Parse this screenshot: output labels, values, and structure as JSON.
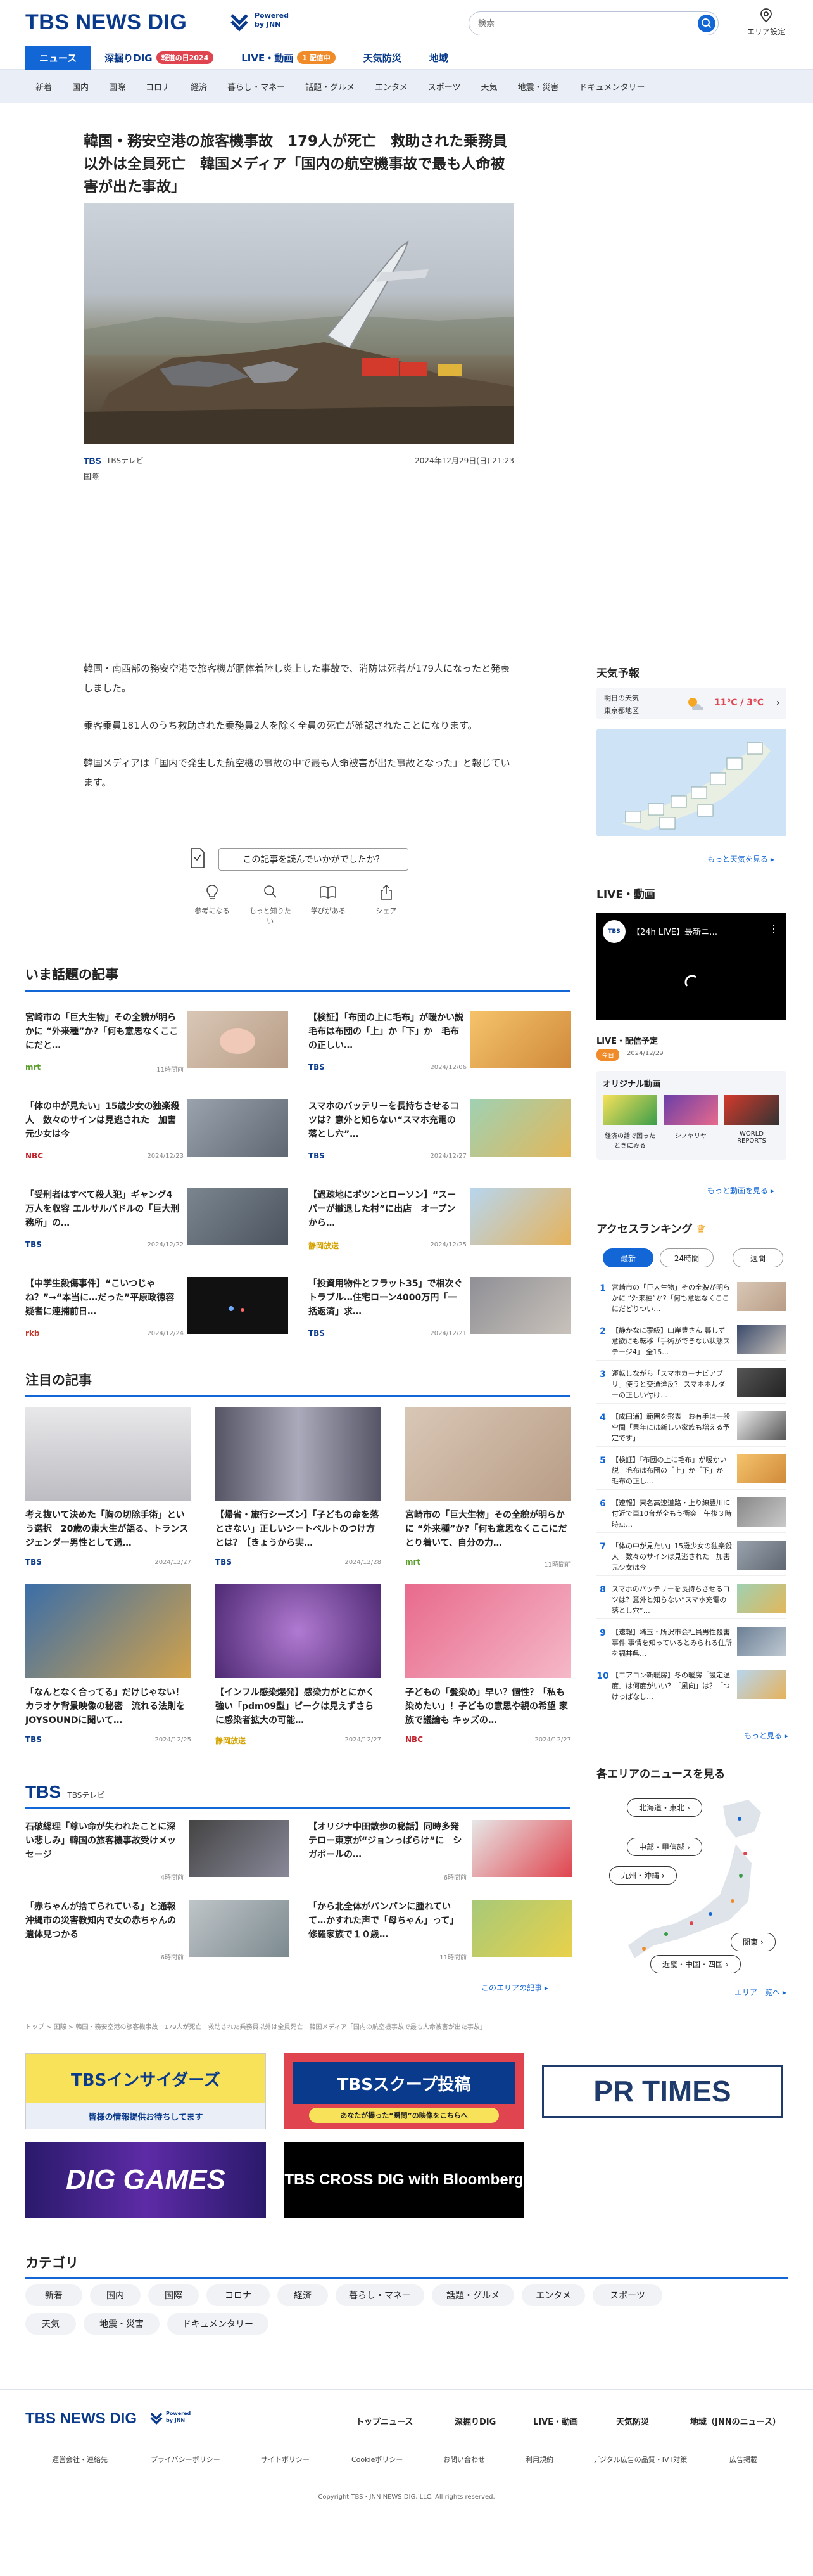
{
  "header": {
    "logo": "TBS NEWS DIG",
    "powered_line1": "Powered",
    "powered_line2": "by JNN",
    "search_placeholder": "検索",
    "area_label": "エリア設定"
  },
  "main_nav": [
    {
      "label": "ニュース",
      "badge": ""
    },
    {
      "label": "深掘りDIG",
      "badge": "報道の日2024"
    },
    {
      "label": "LIVE・動画",
      "badge": "1 配信中"
    },
    {
      "label": "天気防災",
      "badge": ""
    },
    {
      "label": "地域",
      "badge": ""
    }
  ],
  "colors": {
    "brand": "#0a3a8c",
    "accent": "#1266d6",
    "badge_red": "#e0454f",
    "badge_orange": "#f08b2a"
  },
  "sub_nav": [
    "新着",
    "国内",
    "国際",
    "コロナ",
    "経済",
    "暮らし・マネー",
    "話題・グルメ",
    "エンタメ",
    "スポーツ",
    "天気",
    "地震・災害",
    "ドキュメンタリー"
  ],
  "article": {
    "headline": "韓国・務安空港の旅客機事故　179人が死亡　救助された乗務員以外は全員死亡　韓国メディア「国内の航空機事故で最も人命被害が出た事故」",
    "source": "TBSテレビ",
    "category_tag": "国際",
    "datetime": "2024年12月29日(日) 21:23",
    "paragraphs": [
      "韓国・南西部の務安空港で旅客機が胴体着陸し炎上した事故で、消防は死者が179人になったと発表しました。",
      "乗客乗員181人のうち救助された乗務員2人を除く全員の死亡が確認されたことになります。",
      "韓国メディアは「国内で発生した航空機の事故の中で最も人命被害が出た事故となった」と報じています。"
    ],
    "feedback_label": "この記事を読んでいかがでしたか？",
    "reactions": [
      "参考になる",
      "もっと知りたい",
      "学びがある",
      "シェア"
    ]
  },
  "trending": {
    "title": "いま話題の記事",
    "items": [
      {
        "title": "宮崎市の「巨大生物」その全貌が明らかに “外来種”か?「何も意思なくここにだと…",
        "source": "mrt",
        "date": "11時間前"
      },
      {
        "title": "【検証】「布団の上に毛布」が暖かい説　毛布は布団の「上」か「下」か　毛布の正しい…",
        "source": "TBS",
        "date": "2024/12/06"
      },
      {
        "title": "「体の中が見たい」15歳少女の独楽殺人　数々のサインは見逃された　加害元少女は今",
        "source": "NBC",
        "date": "2024/12/23"
      },
      {
        "title": "スマホのバッテリーを長持ちさせるコツは？意外と知らない“スマホ充電の落とし穴”…",
        "source": "TBS",
        "date": "2024/12/27"
      },
      {
        "title": "「受刑者はすべて殺人犯」ギャング4万人を収容 エルサルバドルの「巨大刑務所」の…",
        "source": "TBS",
        "date": "2024/12/22"
      },
      {
        "title": "【過疎地にポツンとローソン】“スーパーが撤退した村”に出店　オープンから…",
        "source": "静岡放送",
        "date": "2024/12/25"
      },
      {
        "title": "【中学生殺傷事件】“こいつじゃね？”→“本当に…だった”平原政徳容疑者に連捕前日…",
        "source": "rkb",
        "date": "2024/12/24"
      },
      {
        "title": "「投資用物件とフラット35」で相次ぐトラブル…住宅ローン4000万円「一括返済」求…",
        "source": "TBS",
        "date": "2024/12/21"
      }
    ]
  },
  "featured": {
    "title": "注目の記事",
    "items": [
      {
        "title": "考え抜いて決めた「胸の切除手術」という選択　20歳の東大生が語る、トランスジェンダー男性として過…",
        "source": "TBS",
        "date": "2024/12/27"
      },
      {
        "title": "【帰省・旅行シーズン】「子どもの命を落とさない」正しいシートベルトのつけ方とは？【きょうから実…",
        "source": "TBS",
        "date": "2024/12/28"
      },
      {
        "title": "宮崎市の「巨大生物」その全貌が明らかに “外来種”か?「何も意思なくここにだとり着いて、自分の力…",
        "source": "mrt",
        "date": "11時間前"
      },
      {
        "title": "「なんとなく合ってる」だけじゃない！ カラオケ背景映像の秘密　流れる法則をJOYSOUNDに聞いて…",
        "source": "TBS",
        "date": "2024/12/25"
      },
      {
        "title": "【インフル感染爆発】感染力がとにかく強い「pdm09型」ピークは見えずさらに感染者拡大の可能…",
        "source": "静岡放送",
        "date": "2024/12/27"
      },
      {
        "title": "子どもの「髪染め」早い？個性？「私も染めたい」！子どもの意思や親の希望 家族で議論も キッズの…",
        "source": "NBC",
        "date": "2024/12/27"
      }
    ]
  },
  "tbs_section": {
    "logo": "TBS",
    "sub": "TBSテレビ",
    "items": [
      {
        "title": "石破総理「尊い命が失われたことに深い悲しみ」韓国の旅客機事故受けメッセージ",
        "date": "4時間前"
      },
      {
        "title": "【オリジナ中田散歩の秘話】同時多発テロー東京が“ジョンっぱらけ”に　シガポールの…",
        "date": "6時間前"
      },
      {
        "title": "「赤ちゃんが捨てられている」と通報　沖縄市の災害教知内で女の赤ちゃんの遺体見つかる",
        "date": "6時間前"
      },
      {
        "title": "「から北全体がパンパンに腫れていて…かすれた声で「母ちゃん」って」修羅家族で１０歳…",
        "date": "11時間前"
      }
    ],
    "more": "このエリアの記事 ▸"
  },
  "breadcrumb": "トップ > 国際 > 韓国・務安空港の旅客機事故　179人が死亡　救助された乗務員以外は全員死亡　韓国メディア「国内の航空機事故で最も人命被害が出た事故」",
  "banners": [
    "TBSインサイダーズ",
    "TBSスクープ投稿",
    "PR TIMES",
    "DIG GAMES",
    "TBS CROSS DIG with Bloomberg"
  ],
  "banner_subs": [
    "皆様の情報提供お待ちしてます",
    "あなたが撮った“瞬間”の映像をこちらへ"
  ],
  "categories": {
    "title": "カテゴリ",
    "items": [
      "新着",
      "国内",
      "国際",
      "コロナ",
      "経済",
      "暮らし・マネー",
      "話題・グルメ",
      "エンタメ",
      "スポーツ",
      "天気",
      "地震・災害",
      "ドキュメンタリー"
    ]
  },
  "sidebar": {
    "weather": {
      "title": "天気予報",
      "day": "明日の天気",
      "region": "東京都地区",
      "temp": "11℃ / 3℃",
      "more": "もっと天気を見る ▸"
    },
    "live": {
      "title": "LIVE・動画",
      "video_title": "【24h LIVE】最新ニ…",
      "schedule_title": "LIVE・配信予定",
      "schedule_tag": "今日",
      "schedule_date": "2024/12/29",
      "original_title": "オリジナル動画",
      "originals": [
        "経済の話で困ったときにみる",
        "シノヤリヤ",
        "WORLD REPORTS"
      ],
      "more": "もっと動画を見る ▸"
    },
    "ranking": {
      "title": "アクセスランキング",
      "tabs": [
        "最新",
        "24時間",
        "週間"
      ],
      "items": [
        "宮崎市の「巨大生物」その全貌が明らかに “外来種”か?「何も意思なくここにだどりつい…",
        "【静かなに覆級】山岸豊さん 暮しず意欲にも転移「手術ができない状態ステージ4」 全15…",
        "運転しながら「スマホカーナビアプリ」使うと交通違反？ スマホホルダーの正しい付け…",
        "【成田浦】範囲を飛表　お有手は一般空間「果年には新しい家族も増える予定です」",
        "【検証】「布団の上に毛布」が暖かい説　毛布は布団の「上」か「下」か　毛布の正し…",
        "【速報】東名高速道路・上り線豊川IC付近で車10台が全もう衝突　午後３時時点…",
        "「体の中が見たい」15歳少女の独楽殺人　数々のサインは見逃された　加害元少女は今",
        "スマホのバッテリーを長持ちさせるコツは？意外と知らない“スマホ充電の落とし穴”…",
        "【速報】埼玉・所沢市会社員男性殺害事件 事情を知っているとみられる住所を福井県…",
        "【エアコン新暖房】冬の暖房「設定温度」は何度がいい？「風向」は？「つけっぱなし…"
      ],
      "more": "もっと見る ▸"
    },
    "area": {
      "title": "各エリアのニュースを見る",
      "buttons": [
        "北海道・東北 ›",
        "中部・甲信越 ›",
        "九州・沖縄 ›",
        "関東 ›",
        "近畿・中国・四国 ›"
      ],
      "more": "エリア一覧へ ▸"
    }
  },
  "footer": {
    "logo": "TBS NEWS DIG",
    "powered_line1": "Powered",
    "powered_line2": "by JNN",
    "links": [
      "トップニュース",
      "深掘りDIG",
      "LIVE・動画",
      "天気防災",
      "地域（JNNのニュース）"
    ],
    "sub_links": [
      "運営会社・連絡先",
      "プライバシーポリシー",
      "サイトポリシー",
      "Cookieポリシー",
      "お問い合わせ",
      "利用規約",
      "デジタル広告の品質・IVT対策",
      "広告掲載"
    ],
    "copyright": "Copyright TBS・JNN NEWS DIG, LLC. All rights reserved."
  }
}
